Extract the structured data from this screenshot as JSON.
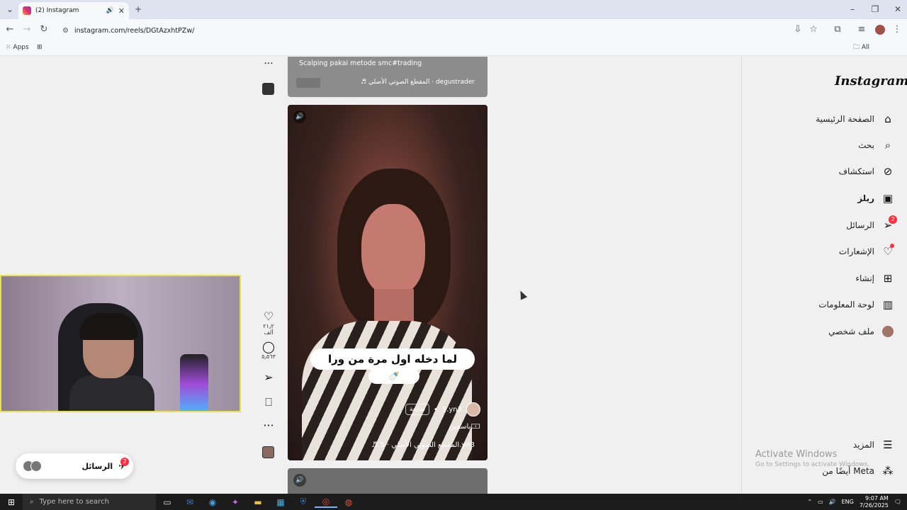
{
  "browser": {
    "tab_title": "(2) Instagram",
    "url": "instagram.com/reels/DGtAzxhtPZw/",
    "bookmarks": {
      "apps": "Apps",
      "all": "All Bookmarks"
    }
  },
  "sidebar": {
    "logo": "Instagram",
    "items": [
      {
        "label": "الصفحة الرئيسية",
        "icon": "home-icon"
      },
      {
        "label": "بحث",
        "icon": "search-icon"
      },
      {
        "label": "استكشاف",
        "icon": "compass-icon"
      },
      {
        "label": "ريلز",
        "icon": "reels-icon"
      },
      {
        "label": "الرسائل",
        "icon": "send-icon",
        "badge": "2"
      },
      {
        "label": "الإشعارات",
        "icon": "heart-icon"
      },
      {
        "label": "إنشاء",
        "icon": "plus-icon"
      },
      {
        "label": "لوحة المعلومات",
        "icon": "dashboard-icon"
      },
      {
        "label": "ملف شخصي",
        "icon": "avatar-icon"
      }
    ],
    "more": "المزيد",
    "also_from_meta": "أيضًا من Meta"
  },
  "watermark": {
    "line1": "Activate Windows",
    "line2": "Go to Settings to activate Windows."
  },
  "reel_prev": {
    "caption": "Scalping pakai metode smc#trading",
    "audio": "♬ المقطع الصوتي الأصلي · degustrader"
  },
  "reel": {
    "subtitle": "لما دخله اول مرة من ورا",
    "subtitle_emoji": "🍼",
    "author": "5.yn3",
    "follow": "متابعة",
    "description": "ياسمين🀱",
    "audio": "♬ المقطع الصوتي الأصلي · 5.yn3",
    "likes": "٢١٫٢ ألف",
    "comments": "٥٫٥٦٣"
  },
  "messages_pill": {
    "label": "الرسائل",
    "badge": "2"
  },
  "taskbar": {
    "search_placeholder": "Type here to search",
    "lang": "ENG",
    "time": "9:07 AM",
    "date": "7/26/2025"
  }
}
